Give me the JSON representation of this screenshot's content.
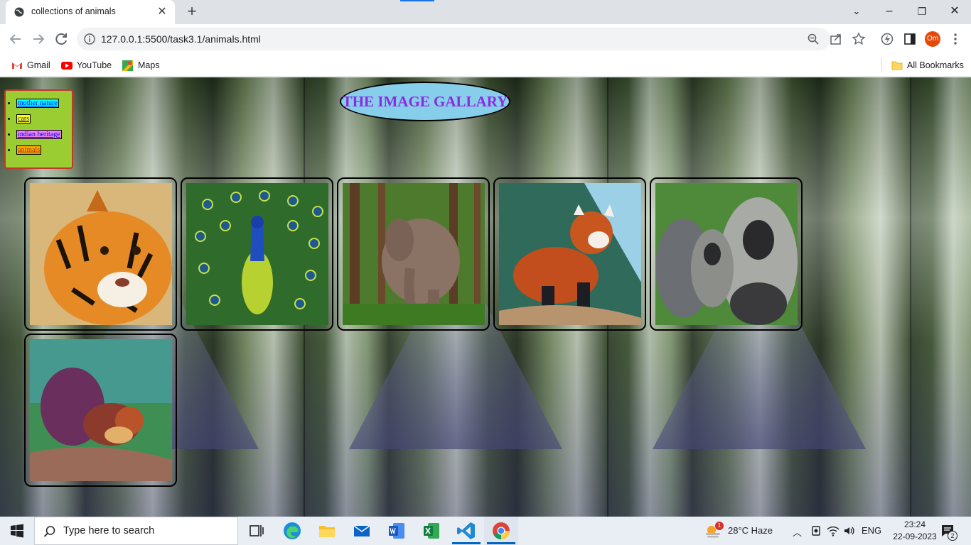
{
  "browser": {
    "tab_title": "collections of animals",
    "url": "127.0.0.1:5500/task3.1/animals.html",
    "profile_initials": "Om",
    "bookmarks": [
      {
        "label": "Gmail",
        "icon": "gmail-icon"
      },
      {
        "label": "YouTube",
        "icon": "youtube-icon"
      },
      {
        "label": "Maps",
        "icon": "maps-icon"
      }
    ],
    "all_bookmarks_label": "All Bookmarks"
  },
  "page": {
    "menu_items": [
      "mother nature",
      "cars",
      "indian heritage",
      "animals"
    ],
    "menu_item_colors": [
      "#00ffff",
      "#ffff00",
      "#ee82ee",
      "#ffa500"
    ],
    "heading": "THE IMAGE GALLARY",
    "gallery": [
      {
        "animal": "tiger"
      },
      {
        "animal": "peacock"
      },
      {
        "animal": "elephant"
      },
      {
        "animal": "red panda"
      },
      {
        "animal": "lion-tailed macaque"
      },
      {
        "animal": "malabar giant squirrel"
      }
    ]
  },
  "taskbar": {
    "search_placeholder": "Type here to search",
    "apps": [
      "task-view-icon",
      "edge-icon",
      "file-explorer-icon",
      "mail-icon",
      "word-icon",
      "excel-icon",
      "vscode-icon",
      "chrome-icon"
    ],
    "weather_badge": "1",
    "weather": "28°C  Haze",
    "language": "ENG",
    "time": "23:24",
    "date": "22-09-2023",
    "notifications": "2"
  },
  "colors": {
    "menu_bg": "#9acd32",
    "heading_bg": "#87ceeb",
    "heading_text": "#8a2be2"
  }
}
